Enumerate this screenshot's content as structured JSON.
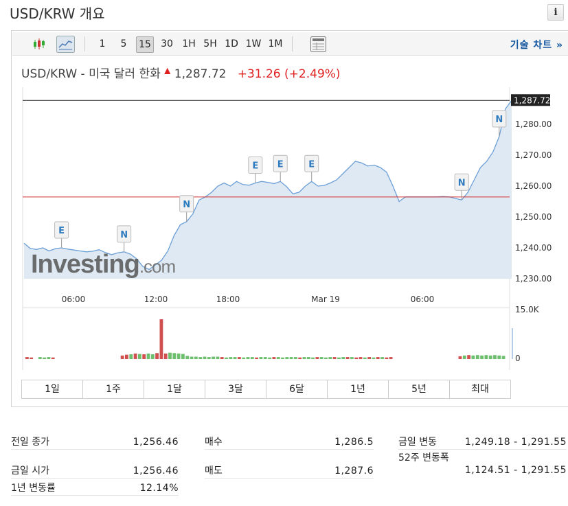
{
  "page": {
    "title": "USD/KRW 개요",
    "info_icon": "i"
  },
  "toolbar": {
    "candle_icon": "candlestick-icon",
    "line_icon": "line-chart-icon",
    "intervals": [
      "1",
      "5",
      "15",
      "30",
      "1H",
      "5H",
      "1D",
      "1W",
      "1M"
    ],
    "active_interval": "15",
    "table_icon": "table-icon",
    "tech_chart_label": "기술 차트 »"
  },
  "quote": {
    "name": "USD/KRW - 미국 달러 한화",
    "arrow": "▲",
    "price": "1,287.72",
    "change": "+31.26",
    "change_pct": "(+2.49%)",
    "up_color": "#e02020"
  },
  "chart_data": {
    "type": "area",
    "x_tick_labels": [
      "06:00",
      "12:00",
      "18:00",
      "Mar 19",
      "06:00"
    ],
    "y_tick_labels": [
      "1,280.00",
      "1,270.00",
      "1,260.00",
      "1,250.00",
      "1,240.00",
      "1,230.00"
    ],
    "ylim": [
      1228,
      1292
    ],
    "last_price_label": "1,287.72",
    "last_price": 1287.72,
    "previous_close": 1256.46,
    "series_color": "#6c9fd6",
    "fill_color": "#dfe9f3",
    "prev_close_line_color": "#d03030",
    "watermark": "Investing.com",
    "series": [
      {
        "values": [
          1241.5,
          1239.8,
          1239.5,
          1240.0,
          1239.0,
          1239.7,
          1240.0,
          1239.6,
          1239.3,
          1239.0,
          1238.7,
          1238.9,
          1239.4,
          1238.5,
          1237.8,
          1238.4,
          1238.7,
          1238.0,
          1236.5,
          1234.0,
          1233.0,
          1234.5,
          1236.0,
          1239.0,
          1244.0,
          1247.5,
          1248.5,
          1251.0,
          1255.5,
          1256.5,
          1258.0,
          1260.0,
          1261.0,
          1260.0,
          1261.5,
          1260.5,
          1260.3,
          1261.0,
          1261.5,
          1261.2,
          1260.8,
          1261.5,
          1259.8,
          1257.5,
          1258.0,
          1260.0,
          1261.5,
          1260.0,
          1260.2,
          1261.0,
          1262.0,
          1264.0,
          1266.0,
          1268.0,
          1267.5,
          1266.5,
          1266.8,
          1266.0,
          1264.5,
          1260.0,
          1255.0,
          1256.5,
          1256.5,
          1256.5,
          1256.5,
          1256.5,
          1256.5,
          1256.6,
          1256.5,
          1256.0,
          1255.5,
          1258.0,
          1262.0,
          1266.0,
          1268.0,
          1271.0,
          1276.0,
          1285.0,
          1287.72
        ]
      }
    ],
    "event_markers": [
      {
        "label": "E",
        "index": 6
      },
      {
        "label": "N",
        "index": 16
      },
      {
        "label": "N",
        "index": 26
      },
      {
        "label": "E",
        "index": 37
      },
      {
        "label": "E",
        "index": 41
      },
      {
        "label": "E",
        "index": 46
      },
      {
        "label": "N",
        "index": 70
      },
      {
        "label": "N",
        "index": 76
      }
    ],
    "volume": {
      "axis_max_label": "15.0K",
      "axis_min_label": "0",
      "up_color": "#6cbf6c",
      "down_color": "#d05050",
      "bars": [
        {
          "v": 0.05,
          "up": false
        },
        {
          "v": 0.04,
          "up": false
        },
        {
          "v": 0,
          "up": true
        },
        {
          "v": 0.05,
          "up": true
        },
        {
          "v": 0.04,
          "up": true
        },
        {
          "v": 0.05,
          "up": true
        },
        {
          "v": 0.04,
          "up": false
        },
        {
          "v": 0,
          "up": true
        },
        {
          "v": 0,
          "up": true
        },
        {
          "v": 0,
          "up": true
        },
        {
          "v": 0,
          "up": true
        },
        {
          "v": 0,
          "up": true
        },
        {
          "v": 0,
          "up": true
        },
        {
          "v": 0,
          "up": true
        },
        {
          "v": 0,
          "up": true
        },
        {
          "v": 0,
          "up": true
        },
        {
          "v": 0,
          "up": true
        },
        {
          "v": 0,
          "up": true
        },
        {
          "v": 0,
          "up": true
        },
        {
          "v": 0,
          "up": true
        },
        {
          "v": 0,
          "up": true
        },
        {
          "v": 0,
          "up": true
        },
        {
          "v": 0.09,
          "up": false
        },
        {
          "v": 0.11,
          "up": false
        },
        {
          "v": 0.12,
          "up": true
        },
        {
          "v": 0.14,
          "up": false
        },
        {
          "v": 0.13,
          "up": true
        },
        {
          "v": 0.12,
          "up": false
        },
        {
          "v": 0.14,
          "up": true
        },
        {
          "v": 0.12,
          "up": true
        },
        {
          "v": 0.15,
          "up": false
        },
        {
          "v": 1.0,
          "up": false
        },
        {
          "v": 0.14,
          "up": false
        },
        {
          "v": 0.16,
          "up": true
        },
        {
          "v": 0.15,
          "up": true
        },
        {
          "v": 0.14,
          "up": true
        },
        {
          "v": 0.13,
          "up": true
        },
        {
          "v": 0.08,
          "up": true
        },
        {
          "v": 0.06,
          "up": true
        },
        {
          "v": 0.06,
          "up": true
        },
        {
          "v": 0.05,
          "up": true
        },
        {
          "v": 0.06,
          "up": true
        },
        {
          "v": 0.05,
          "up": true
        },
        {
          "v": 0.06,
          "up": true
        },
        {
          "v": 0.06,
          "up": true
        },
        {
          "v": 0.05,
          "up": false
        },
        {
          "v": 0.04,
          "up": true
        },
        {
          "v": 0.05,
          "up": true
        },
        {
          "v": 0.05,
          "up": true
        },
        {
          "v": 0.05,
          "up": false
        },
        {
          "v": 0.04,
          "up": true
        },
        {
          "v": 0.05,
          "up": true
        },
        {
          "v": 0.05,
          "up": true
        },
        {
          "v": 0.04,
          "up": false
        },
        {
          "v": 0.05,
          "up": true
        },
        {
          "v": 0.05,
          "up": true
        },
        {
          "v": 0.04,
          "up": true
        },
        {
          "v": 0.05,
          "up": false
        },
        {
          "v": 0.05,
          "up": true
        },
        {
          "v": 0.04,
          "up": true
        },
        {
          "v": 0.05,
          "up": true
        },
        {
          "v": 0.05,
          "up": true
        },
        {
          "v": 0.05,
          "up": true
        },
        {
          "v": 0.04,
          "up": false
        },
        {
          "v": 0.05,
          "up": true
        },
        {
          "v": 0.05,
          "up": true
        },
        {
          "v": 0.04,
          "up": true
        },
        {
          "v": 0.05,
          "up": false
        },
        {
          "v": 0.05,
          "up": true
        },
        {
          "v": 0.04,
          "up": true
        },
        {
          "v": 0.05,
          "up": true
        },
        {
          "v": 0.05,
          "up": false
        },
        {
          "v": 0.04,
          "up": true
        },
        {
          "v": 0.05,
          "up": true
        },
        {
          "v": 0.05,
          "up": false
        },
        {
          "v": 0.05,
          "up": true
        },
        {
          "v": 0.04,
          "up": false
        },
        {
          "v": 0.05,
          "up": false
        },
        {
          "v": 0.04,
          "up": true
        },
        {
          "v": 0.05,
          "up": false
        },
        {
          "v": 0.04,
          "up": true
        },
        {
          "v": 0.05,
          "up": false
        },
        {
          "v": 0.05,
          "up": true
        },
        {
          "v": 0.04,
          "up": false
        },
        {
          "v": 0.05,
          "up": false
        },
        {
          "v": 0,
          "up": true
        },
        {
          "v": 0,
          "up": true
        },
        {
          "v": 0,
          "up": true
        },
        {
          "v": 0,
          "up": true
        },
        {
          "v": 0,
          "up": true
        },
        {
          "v": 0,
          "up": true
        },
        {
          "v": 0,
          "up": true
        },
        {
          "v": 0,
          "up": true
        },
        {
          "v": 0,
          "up": true
        },
        {
          "v": 0,
          "up": true
        },
        {
          "v": 0,
          "up": true
        },
        {
          "v": 0,
          "up": true
        },
        {
          "v": 0,
          "up": true
        },
        {
          "v": 0,
          "up": true
        },
        {
          "v": 0,
          "up": true
        },
        {
          "v": 0.07,
          "up": false
        },
        {
          "v": 0.09,
          "up": true
        },
        {
          "v": 0.1,
          "up": false
        },
        {
          "v": 0.09,
          "up": true
        },
        {
          "v": 0.1,
          "up": true
        },
        {
          "v": 0.09,
          "up": true
        },
        {
          "v": 0.1,
          "up": true
        },
        {
          "v": 0.09,
          "up": true
        },
        {
          "v": 0.1,
          "up": true
        },
        {
          "v": 0.09,
          "up": true
        },
        {
          "v": 0.08,
          "up": true
        }
      ]
    }
  },
  "periods": [
    "1일",
    "1주",
    "1달",
    "3달",
    "6달",
    "1년",
    "5년",
    "최대"
  ],
  "stats": {
    "prev_close_label": "전일 종가",
    "prev_close": "1,256.46",
    "bid_label": "매수",
    "bid": "1,286.5",
    "day_range_label": "금일 변동",
    "day_range": "1,249.18 - 1,291.55",
    "week52_label": "52주 변동폭",
    "week52": "1,124.51 - 1,291.55",
    "open_label": "금일 시가",
    "open": "1,256.46",
    "ask_label": "매도",
    "ask": "1,287.6",
    "year_change_label": "1년 변동률",
    "year_change": "12.14%"
  }
}
